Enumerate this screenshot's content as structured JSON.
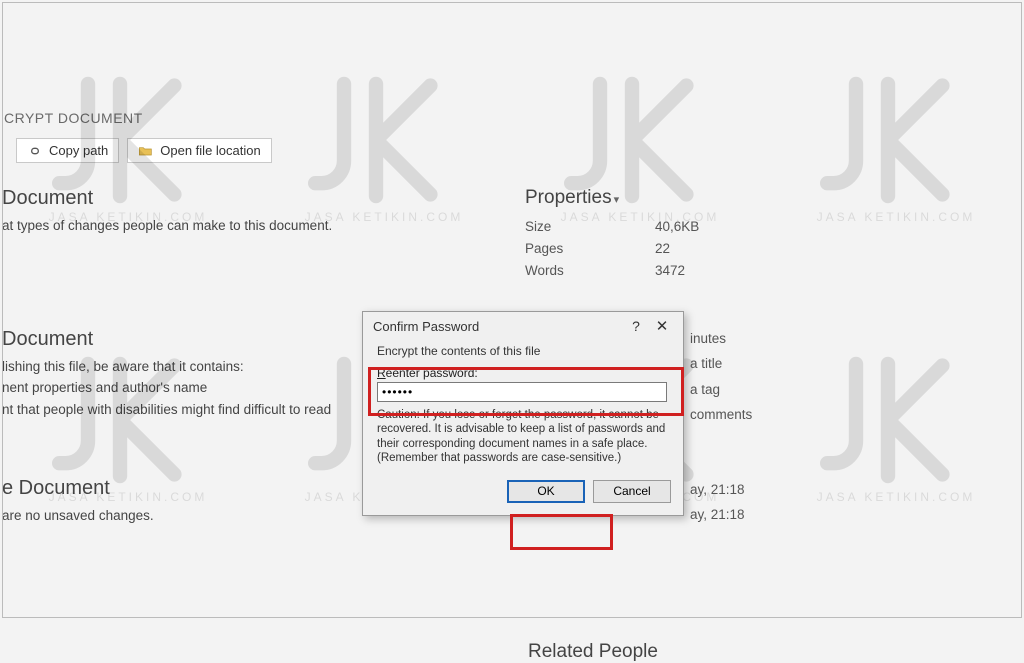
{
  "header": {
    "doc_label": "CRYPT DOCUMENT"
  },
  "toolbar": {
    "copy_path": "Copy path",
    "open_location": "Open file location"
  },
  "sections": {
    "protect": {
      "title": "Document",
      "line": "at types of changes people can make to this document."
    },
    "inspect": {
      "title": "Document",
      "line1": "lishing this file, be aware that it contains:",
      "bullet1": "nent properties and author's name",
      "bullet2": "nt that people with disabilities might find difficult to read"
    },
    "manage": {
      "title": "e Document",
      "line": "are no unsaved changes."
    }
  },
  "properties": {
    "heading": "Properties",
    "rows": {
      "size_k": "Size",
      "size_v": "40,6KB",
      "pages_k": "Pages",
      "pages_v": "22",
      "words_k": "Words",
      "words_v": "3472",
      "edit_k_tail": "inutes",
      "title_k_tail": "a title",
      "tags_k_tail": "a tag",
      "comments_k_tail": "comments",
      "mod_v_tail": "ay, 21:18",
      "create_v_tail": "ay, 21:18"
    },
    "related_heading": "Related People"
  },
  "dialog": {
    "title": "Confirm Password",
    "subtitle": "Encrypt the contents of this file",
    "label_prefix": "R",
    "label_rest": "eenter password:",
    "password_value": "••••••",
    "caution": "Caution: If you lose or forget the password, it cannot be recovered. It is advisable to keep a list of passwords and their corresponding document names in a safe place.",
    "caution2": "(Remember that passwords are case-sensitive.)",
    "ok": "OK",
    "cancel": "Cancel"
  },
  "watermark_caption": "JASA KETIKIN.COM"
}
